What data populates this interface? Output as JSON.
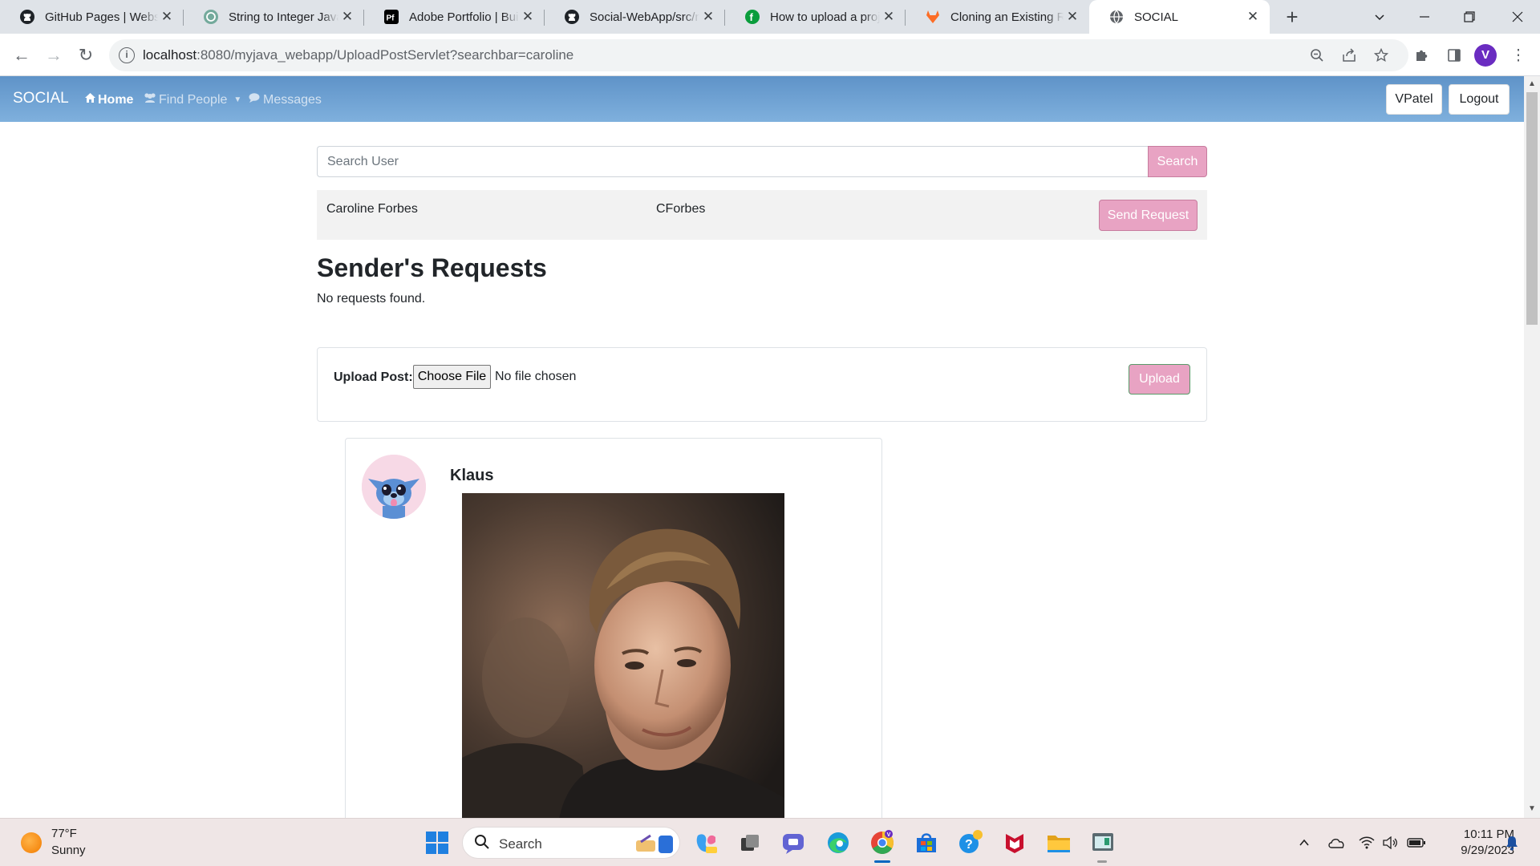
{
  "browser": {
    "tabs": [
      {
        "title": "GitHub Pages | Websites for you and your projects",
        "favicon": "github-icon"
      },
      {
        "title": "String to Integer Java",
        "favicon": "openai-icon"
      },
      {
        "title": "Adobe Portfolio | Build your portfolio website",
        "favicon": "adobe-portfolio-icon"
      },
      {
        "title": "Social-WebApp/src/main",
        "favicon": "github-icon"
      },
      {
        "title": "How to upload a project to GitHub",
        "favicon": "freecodecamp-icon"
      },
      {
        "title": "Cloning an Existing Repository",
        "favicon": "gitlab-icon"
      },
      {
        "title": "SOCIAL",
        "favicon": "globe-icon"
      }
    ],
    "url_host": "localhost",
    "url_rest": ":8080/myjava_webapp/UploadPostServlet?searchbar=caroline",
    "profile_initial": "V"
  },
  "navbar": {
    "brand": "SOCIAL",
    "home": "Home",
    "find_people": "Find People",
    "messages": "Messages",
    "user": "VPatel",
    "logout": "Logout"
  },
  "search": {
    "placeholder": "Search User",
    "button": "Search"
  },
  "result": {
    "name": "Caroline Forbes",
    "username": "CForbes",
    "action": "Send Request"
  },
  "requests": {
    "heading": "Sender's Requests",
    "empty": "No requests found."
  },
  "upload": {
    "label": "Upload Post:",
    "choose": "Choose File",
    "status": "No file chosen",
    "button": "Upload"
  },
  "post": {
    "author": "Klaus"
  },
  "taskbar": {
    "temp": "77°F",
    "condition": "Sunny",
    "search": "Search",
    "time": "10:11 PM",
    "date": "9/29/2023"
  },
  "colors": {
    "accent_pink": "#e8a3c3",
    "navbar_blue": "#6a9fd3",
    "profile_purple": "#6a2cc1"
  }
}
